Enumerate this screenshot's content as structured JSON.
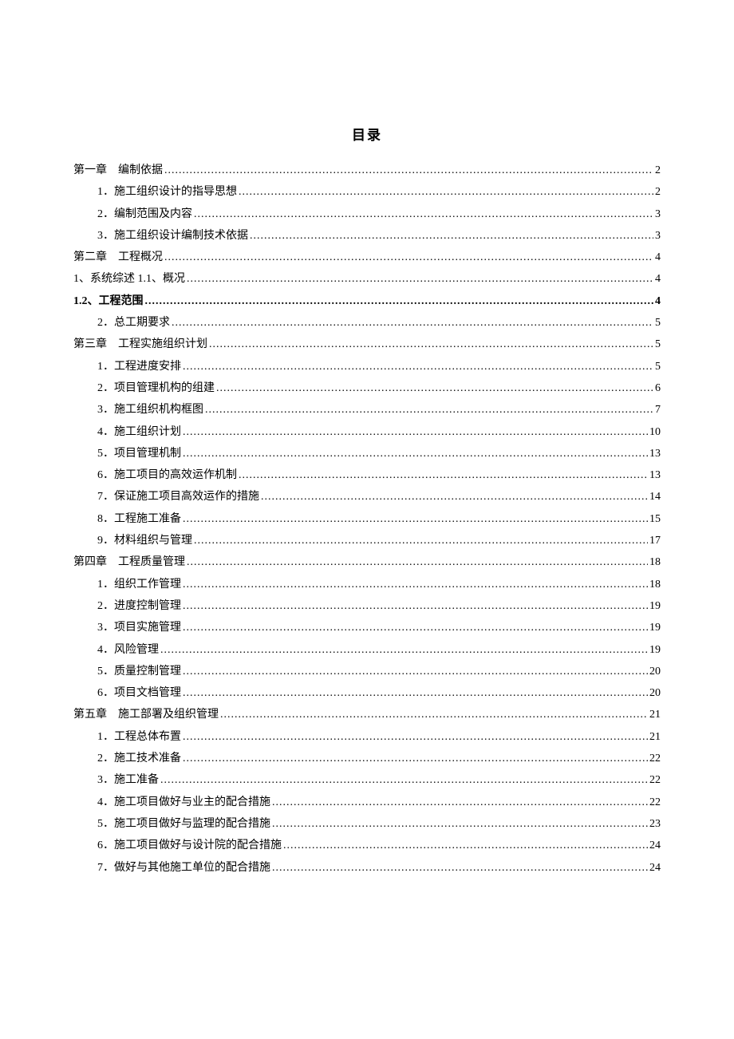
{
  "title": "目录",
  "toc": [
    {
      "level": 1,
      "label": "第一章　编制依据",
      "page": "2",
      "bold": false
    },
    {
      "level": 2,
      "label": "1．施工组织设计的指导思想",
      "page": "2",
      "bold": false
    },
    {
      "level": 2,
      "label": "2．编制范围及内容",
      "page": "3",
      "bold": false
    },
    {
      "level": 2,
      "label": "3．施工组织设计编制技术依据",
      "page": "3",
      "bold": false
    },
    {
      "level": 1,
      "label": "第二章　工程概况",
      "page": "4",
      "bold": false
    },
    {
      "level": 1,
      "label": "1、系统综述 1.1、概况",
      "page": "4",
      "bold": false
    },
    {
      "level": 1,
      "label": "1.2、工程范围",
      "page": "4",
      "bold": true
    },
    {
      "level": 2,
      "label": "2．总工期要求",
      "page": "5",
      "bold": false
    },
    {
      "level": 1,
      "label": "第三章　工程实施组织计划",
      "page": "5",
      "bold": false
    },
    {
      "level": 2,
      "label": "1．工程进度安排",
      "page": "5",
      "bold": false
    },
    {
      "level": 2,
      "label": "2．项目管理机构的组建",
      "page": "6",
      "bold": false
    },
    {
      "level": 2,
      "label": "3．施工组织机构框图",
      "page": "7",
      "bold": false
    },
    {
      "level": 2,
      "label": "4．施工组织计划",
      "page": "10",
      "bold": false
    },
    {
      "level": 2,
      "label": "5．项目管理机制",
      "page": "13",
      "bold": false
    },
    {
      "level": 2,
      "label": "6．施工项目的高效运作机制",
      "page": "13",
      "bold": false
    },
    {
      "level": 2,
      "label": "7．保证施工项目高效运作的措施",
      "page": "14",
      "bold": false
    },
    {
      "level": 2,
      "label": "8．工程施工准备",
      "page": "15",
      "bold": false
    },
    {
      "level": 2,
      "label": "9．材料组织与管理",
      "page": "17",
      "bold": false
    },
    {
      "level": 1,
      "label": "第四章　工程质量管理",
      "page": "18",
      "bold": false
    },
    {
      "level": 2,
      "label": "1．组织工作管理",
      "page": "18",
      "bold": false
    },
    {
      "level": 2,
      "label": "2．进度控制管理",
      "page": "19",
      "bold": false
    },
    {
      "level": 2,
      "label": "3．项目实施管理",
      "page": "19",
      "bold": false
    },
    {
      "level": 2,
      "label": "4．风险管理",
      "page": "19",
      "bold": false
    },
    {
      "level": 2,
      "label": "5．质量控制管理",
      "page": "20",
      "bold": false
    },
    {
      "level": 2,
      "label": "6．项目文档管理",
      "page": "20",
      "bold": false
    },
    {
      "level": 1,
      "label": "第五章　施工部署及组织管理",
      "page": "21",
      "bold": false
    },
    {
      "level": 2,
      "label": "1．工程总体布置",
      "page": "21",
      "bold": false
    },
    {
      "level": 2,
      "label": "2．施工技术准备",
      "page": "22",
      "bold": false
    },
    {
      "level": 2,
      "label": "3．施工准备",
      "page": "22",
      "bold": false
    },
    {
      "level": 2,
      "label": "4．施工项目做好与业主的配合措施",
      "page": "22",
      "bold": false
    },
    {
      "level": 2,
      "label": "5．施工项目做好与监理的配合措施",
      "page": "23",
      "bold": false
    },
    {
      "level": 2,
      "label": "6．施工项目做好与设计院的配合措施",
      "page": "24",
      "bold": false
    },
    {
      "level": 2,
      "label": "7．做好与其他施工单位的配合措施",
      "page": "24",
      "bold": false
    }
  ]
}
